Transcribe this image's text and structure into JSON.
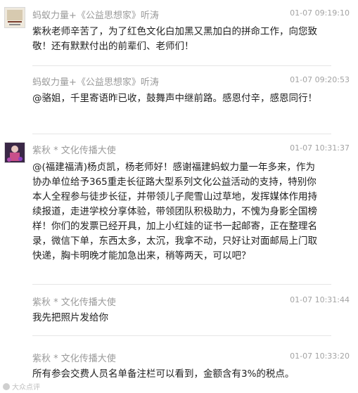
{
  "messages": [
    {
      "author": "蚂蚁力量+《公益思想家》听涛",
      "time": "01-07 09:19:10",
      "text": "紫秋老师辛苦了，为了红色文化白加黑又黑加白的拼命工作，向您致敬！还有默默付出的前辈们、老师们！",
      "avatar": "ant-power-avatar"
    },
    {
      "author": "蚂蚁力量+《公益思想家》听涛",
      "time": "01-07 09:20:53",
      "text": "@骆姐，千里寄语昨已收，鼓舞声中继前路。感恩付辛，感恩同行！"
    },
    {
      "author": "紫秋 * 文化传播大使",
      "time": "01-07 10:31:37",
      "text": "@(福建福清)杨贞凯，杨老师好！感谢福建蚂蚁力量一年多来，作为协办单位给予365重走长征路大型系列文化公益活动的支持，特别你本人全程参与徒步长征，并带领儿子爬雪山过草地，发挥媒体作用持续报道，走进学校分享体验，带领团队积极助力，不愧为身影全国榜样！你们的发票已经开具，加上小红娃的证书一起邮寄，正在整理名录，微信下单，东西太多，太沉，我拿不动，只好让对面邮局上门取快递，胸卡明晚才能加急出来，稍等两天，可以吧？",
      "avatar": "purple-flower-avatar"
    },
    {
      "author": "紫秋 * 文化传播大使",
      "time": "01-07 10:31:44",
      "text": "我先把照片发给你"
    },
    {
      "author": "紫秋 * 文化传播大使",
      "time": "01-07 10:33:20",
      "text": "所有参会交费人员名单备注栏可以看到，金额含有3%的税点。"
    }
  ],
  "watermark": "大众点评",
  "colors": {
    "text": "#222222",
    "meta": "#9a9a9a",
    "divider": "#e6e6e6"
  }
}
